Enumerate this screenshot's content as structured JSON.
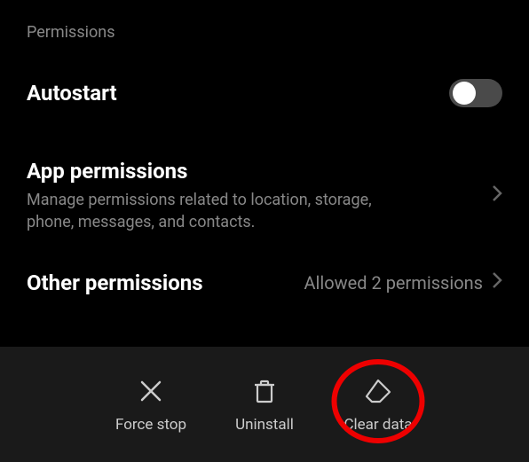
{
  "section_header": "Permissions",
  "rows": {
    "autostart": {
      "title": "Autostart",
      "toggle_on": false
    },
    "app_permissions": {
      "title": "App permissions",
      "subtitle": "Manage permissions related to location, storage, phone, messages, and contacts."
    },
    "other_permissions": {
      "title": "Other permissions",
      "value": "Allowed 2 permissions"
    }
  },
  "bottom_actions": {
    "force_stop": "Force stop",
    "uninstall": "Uninstall",
    "clear_data": "Clear data"
  },
  "colors": {
    "highlight": "#e00"
  }
}
